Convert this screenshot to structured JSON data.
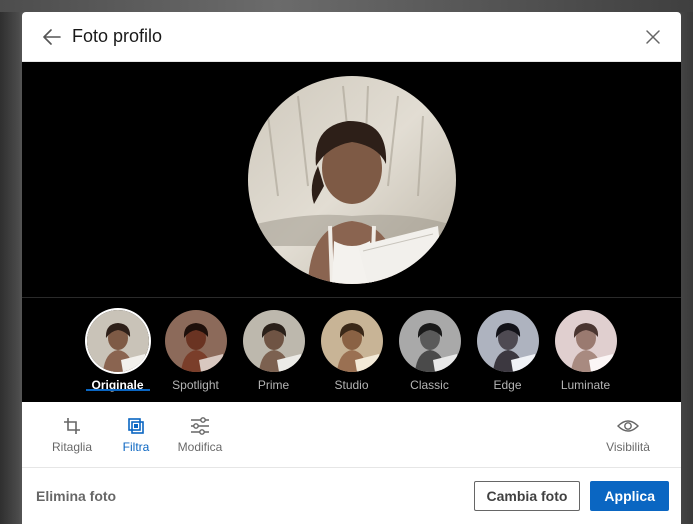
{
  "modal": {
    "title": "Foto profilo",
    "back_icon": "arrow-left-icon",
    "close_icon": "close-icon"
  },
  "preview": {
    "photo": "profile-photo-woman"
  },
  "filters": {
    "selected": "Originale",
    "items": [
      {
        "label": "Originale",
        "tint": "#8a8a82"
      },
      {
        "label": "Spotlight",
        "tint": "#a05a45"
      },
      {
        "label": "Prime",
        "tint": "#9a9a92"
      },
      {
        "label": "Studio",
        "tint": "#b8a488"
      },
      {
        "label": "Classic",
        "tint": "#6e6e6e"
      },
      {
        "label": "Edge",
        "tint": "#9aa0ad"
      },
      {
        "label": "Luminate",
        "tint": "#d9c2c2"
      }
    ]
  },
  "toolbar": {
    "crop_label": "Ritaglia",
    "crop_icon": "crop-icon",
    "filter_label": "Filtra",
    "filter_icon": "filter-icon",
    "edit_label": "Modifica",
    "edit_icon": "sliders-icon",
    "visibility_label": "Visibilità",
    "visibility_icon": "eye-icon"
  },
  "footer": {
    "delete_label": "Elimina foto",
    "change_label": "Cambia foto",
    "apply_label": "Applica"
  },
  "colors": {
    "accent": "#0a66c2",
    "preview_bg": "#000000"
  }
}
